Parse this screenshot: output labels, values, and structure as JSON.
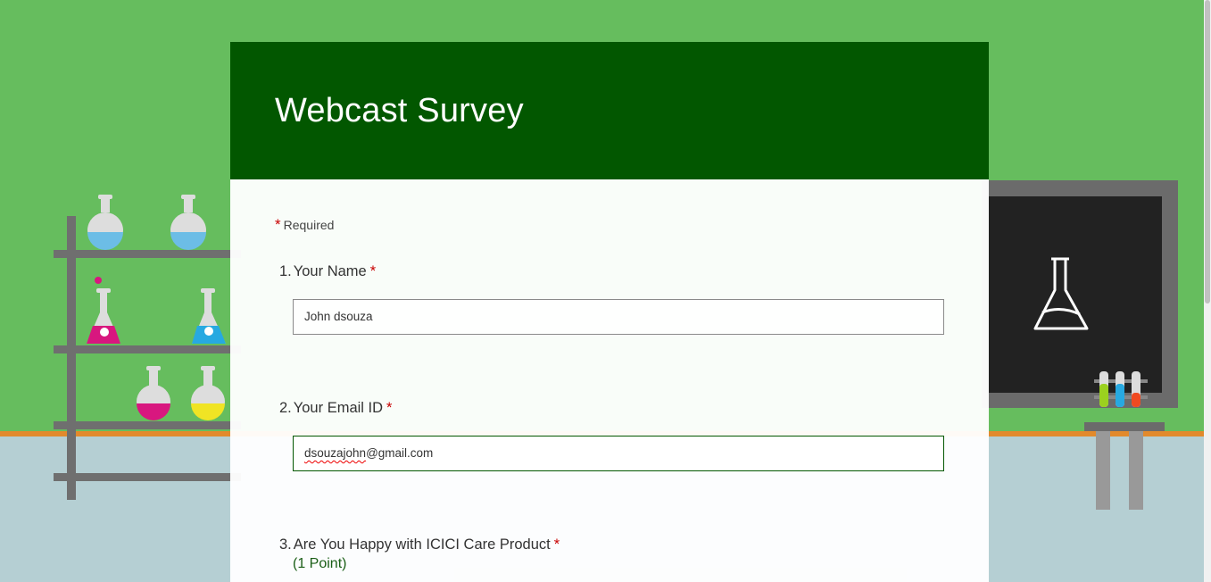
{
  "form": {
    "title": "Webcast Survey",
    "required_mark": "*",
    "required_label": "Required"
  },
  "questions": [
    {
      "number": "1.",
      "label": "Your Name",
      "required_mark": "*",
      "value": "John dsouza"
    },
    {
      "number": "2.",
      "label": "Your Email ID",
      "required_mark": "*",
      "value_misspelled": "dsouzajohn",
      "value_rest": "@gmail.com"
    },
    {
      "number": "3.",
      "label": "Are You Happy with ICICI Care Product",
      "required_mark": "*",
      "points": "(1 Point)"
    }
  ],
  "colors": {
    "background": "#66bd5e",
    "header": "#025700",
    "floor": "#b5cfd3",
    "required": "#c80000"
  },
  "icons": [
    "lab-shelf-illustration",
    "flask-icon",
    "chalkboard-illustration",
    "test-tube-rack-icon",
    "beaker-icon"
  ]
}
